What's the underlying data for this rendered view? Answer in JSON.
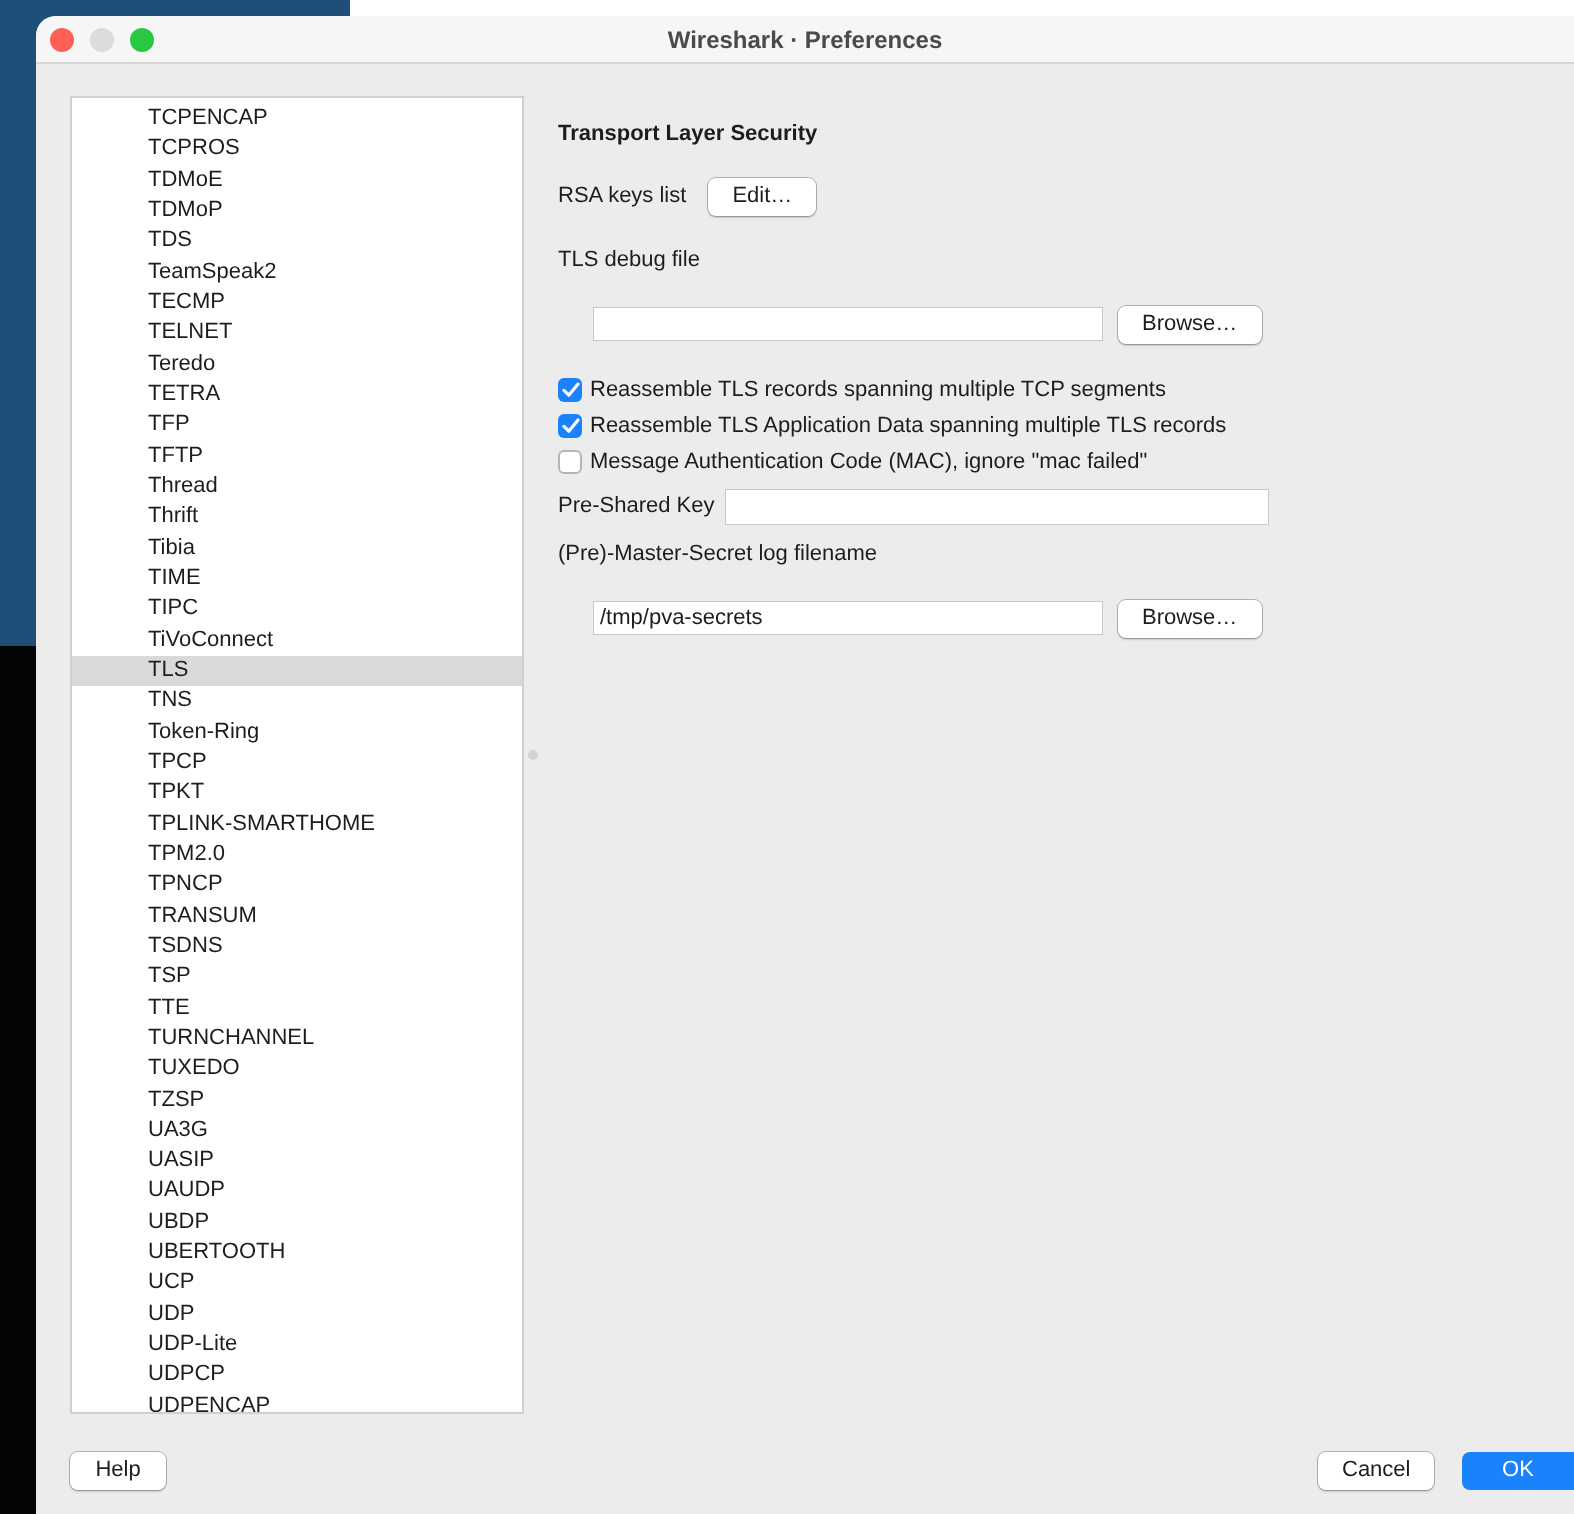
{
  "window": {
    "title": "Wireshark · Preferences"
  },
  "protocols": [
    {
      "label": "TCPENCAP",
      "selected": false
    },
    {
      "label": "TCPROS",
      "selected": false
    },
    {
      "label": "TDMoE",
      "selected": false
    },
    {
      "label": "TDMoP",
      "selected": false
    },
    {
      "label": "TDS",
      "selected": false
    },
    {
      "label": "TeamSpeak2",
      "selected": false
    },
    {
      "label": "TECMP",
      "selected": false
    },
    {
      "label": "TELNET",
      "selected": false
    },
    {
      "label": "Teredo",
      "selected": false
    },
    {
      "label": "TETRA",
      "selected": false
    },
    {
      "label": "TFP",
      "selected": false
    },
    {
      "label": "TFTP",
      "selected": false
    },
    {
      "label": "Thread",
      "selected": false
    },
    {
      "label": "Thrift",
      "selected": false
    },
    {
      "label": "Tibia",
      "selected": false
    },
    {
      "label": "TIME",
      "selected": false
    },
    {
      "label": "TIPC",
      "selected": false
    },
    {
      "label": "TiVoConnect",
      "selected": false
    },
    {
      "label": "TLS",
      "selected": true
    },
    {
      "label": "TNS",
      "selected": false
    },
    {
      "label": "Token-Ring",
      "selected": false
    },
    {
      "label": "TPCP",
      "selected": false
    },
    {
      "label": "TPKT",
      "selected": false
    },
    {
      "label": "TPLINK-SMARTHOME",
      "selected": false
    },
    {
      "label": "TPM2.0",
      "selected": false
    },
    {
      "label": "TPNCP",
      "selected": false
    },
    {
      "label": "TRANSUM",
      "selected": false
    },
    {
      "label": "TSDNS",
      "selected": false
    },
    {
      "label": "TSP",
      "selected": false
    },
    {
      "label": "TTE",
      "selected": false
    },
    {
      "label": "TURNCHANNEL",
      "selected": false
    },
    {
      "label": "TUXEDO",
      "selected": false
    },
    {
      "label": "TZSP",
      "selected": false
    },
    {
      "label": "UA3G",
      "selected": false
    },
    {
      "label": "UASIP",
      "selected": false
    },
    {
      "label": "UAUDP",
      "selected": false
    },
    {
      "label": "UBDP",
      "selected": false
    },
    {
      "label": "UBERTOOTH",
      "selected": false
    },
    {
      "label": "UCP",
      "selected": false
    },
    {
      "label": "UDP",
      "selected": false
    },
    {
      "label": "UDP-Lite",
      "selected": false
    },
    {
      "label": "UDPCP",
      "selected": false
    },
    {
      "label": "UDPENCAP",
      "selected": false
    }
  ],
  "pane": {
    "title": "Transport Layer Security",
    "rows": [
      {
        "kind": "button",
        "label": "RSA keys list",
        "button": "Edit…"
      },
      {
        "kind": "label",
        "label": "TLS debug file"
      },
      {
        "kind": "file",
        "button": "Browse…"
      },
      {
        "kind": "checkbox",
        "label": "Reassemble TLS records spanning multiple TCP segments",
        "checked": true
      },
      {
        "kind": "checkbox",
        "label": "Reassemble TLS Application Data spanning multiple TLS records",
        "checked": true
      },
      {
        "kind": "checkbox",
        "label": "Message Authentication Code (MAC), ignore \"mac failed\"",
        "checked": false
      },
      {
        "kind": "text",
        "label": "Pre-Shared Key"
      },
      {
        "kind": "label",
        "label": "(Pre)-Master-Secret log filename"
      },
      {
        "kind": "file",
        "value": "/tmp/pva-secrets",
        "button": "Browse…"
      }
    ]
  },
  "footer": {
    "left": [
      {
        "label": "Help",
        "default": false
      }
    ],
    "right": [
      {
        "label": "Cancel",
        "default": false
      },
      {
        "label": "OK",
        "default": true
      }
    ]
  }
}
